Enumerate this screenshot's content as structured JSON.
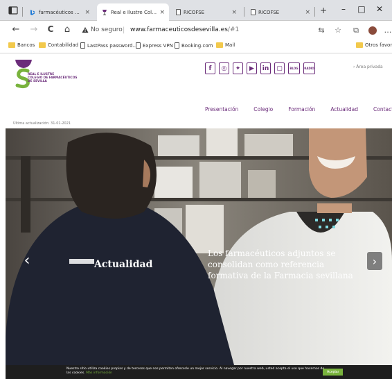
{
  "browser": {
    "tabs": [
      {
        "title": "farmacéuticos de sevilla",
        "active": false
      },
      {
        "title": "Real e Ilustre Colegio de",
        "active": true
      },
      {
        "title": "RICOFSE",
        "active": false
      },
      {
        "title": "RICOFSE",
        "active": false
      }
    ],
    "tab_close": "×",
    "new_tab": "+",
    "window": {
      "minimize": "–",
      "maximize": "□",
      "close": "✕"
    },
    "nav": {
      "back": "←",
      "forward": "→",
      "reload": "C",
      "home": "⌂"
    },
    "security_label": "No seguro",
    "url_host": "www.farmaceuticosdesevilla.es",
    "url_hash": "/#1",
    "bookmarks": [
      {
        "label": "Bancos",
        "kind": "folder"
      },
      {
        "label": "Contabilidad",
        "kind": "folder"
      },
      {
        "label": "LastPass password...",
        "kind": "page"
      },
      {
        "label": "Express VPN",
        "kind": "page"
      },
      {
        "label": "Booking.com",
        "kind": "page"
      },
      {
        "label": "Mail",
        "kind": "folder"
      }
    ],
    "other_favorites": "Otros favorito",
    "accent": "#f2c94c"
  },
  "site": {
    "logo_lines": [
      "REAL E ILUSTRE",
      "COLEGIO DE FARMACÉUTICOS",
      "DE SEVILLA"
    ],
    "social": [
      {
        "icon": "facebook-icon",
        "glyph": "f"
      },
      {
        "icon": "instagram-icon",
        "glyph": "◎"
      },
      {
        "icon": "twitter-icon",
        "glyph": "✦"
      },
      {
        "icon": "youtube-icon",
        "glyph": "▶"
      },
      {
        "icon": "linkedin-icon",
        "glyph": "in"
      },
      {
        "icon": "tablet-icon",
        "glyph": "▢"
      },
      {
        "icon": "blog-icon",
        "glyph": "BLOG"
      },
      {
        "icon": "radio-icon",
        "glyph": "RADIO"
      }
    ],
    "private_area": "› Área privada",
    "nav": [
      "Presentación",
      "Colegio",
      "Formación",
      "Actualidad",
      "Contacto"
    ],
    "last_updated": "Última actualización: 31-01-2021",
    "brand_color": "#6b2c7a",
    "logo_green": "#79b33d"
  },
  "hero": {
    "label": "Actualidad",
    "caption": "Los farmacéuticos adjuntos se consolidan como referencia formativa de la Farmacia sevillana",
    "prev": "‹",
    "next": "›"
  },
  "cookie": {
    "text": "Nuestro sitio utiliza cookies propias y de terceros que nos permiten ofrecerle un mejor servicio. Al navegar por nuestra web, usted acepta el uso que hacemos de las cookies.",
    "link": "Más información",
    "button": "Aceptar"
  }
}
